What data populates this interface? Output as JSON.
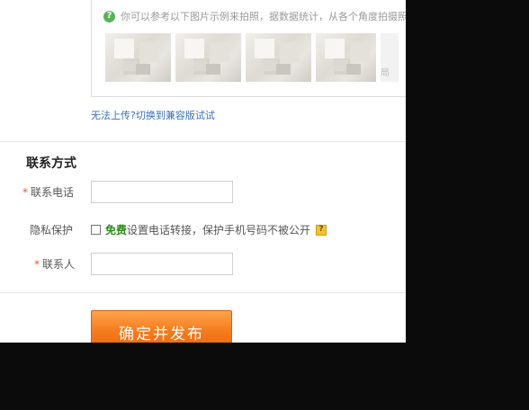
{
  "photo_tip": {
    "icon": "question-icon",
    "icon_glyph": "?",
    "text": "你可以参考以下图片示例来拍照，据数据统计，从各个角度拍摄照片",
    "thumb_cut_label": "局"
  },
  "upload": {
    "switch_link": "无法上传?切换到兼容版试试"
  },
  "contact": {
    "section_title": "联系方式",
    "phone_label": "联系电话",
    "required_mark": "*",
    "phone_value": "",
    "privacy_label": "隐私保护",
    "privacy_free": "免费",
    "privacy_text": "设置电话转接，保护手机号码不被公开",
    "help_icon_glyph": "?",
    "contact_person_label": "联系人",
    "contact_person_value": ""
  },
  "actions": {
    "submit_label": "确定并发布"
  },
  "colors": {
    "link": "#3b6fb6",
    "free_green": "#2a8a1a",
    "required_orange": "#e05a2a",
    "button_orange": "#f57a1c"
  }
}
